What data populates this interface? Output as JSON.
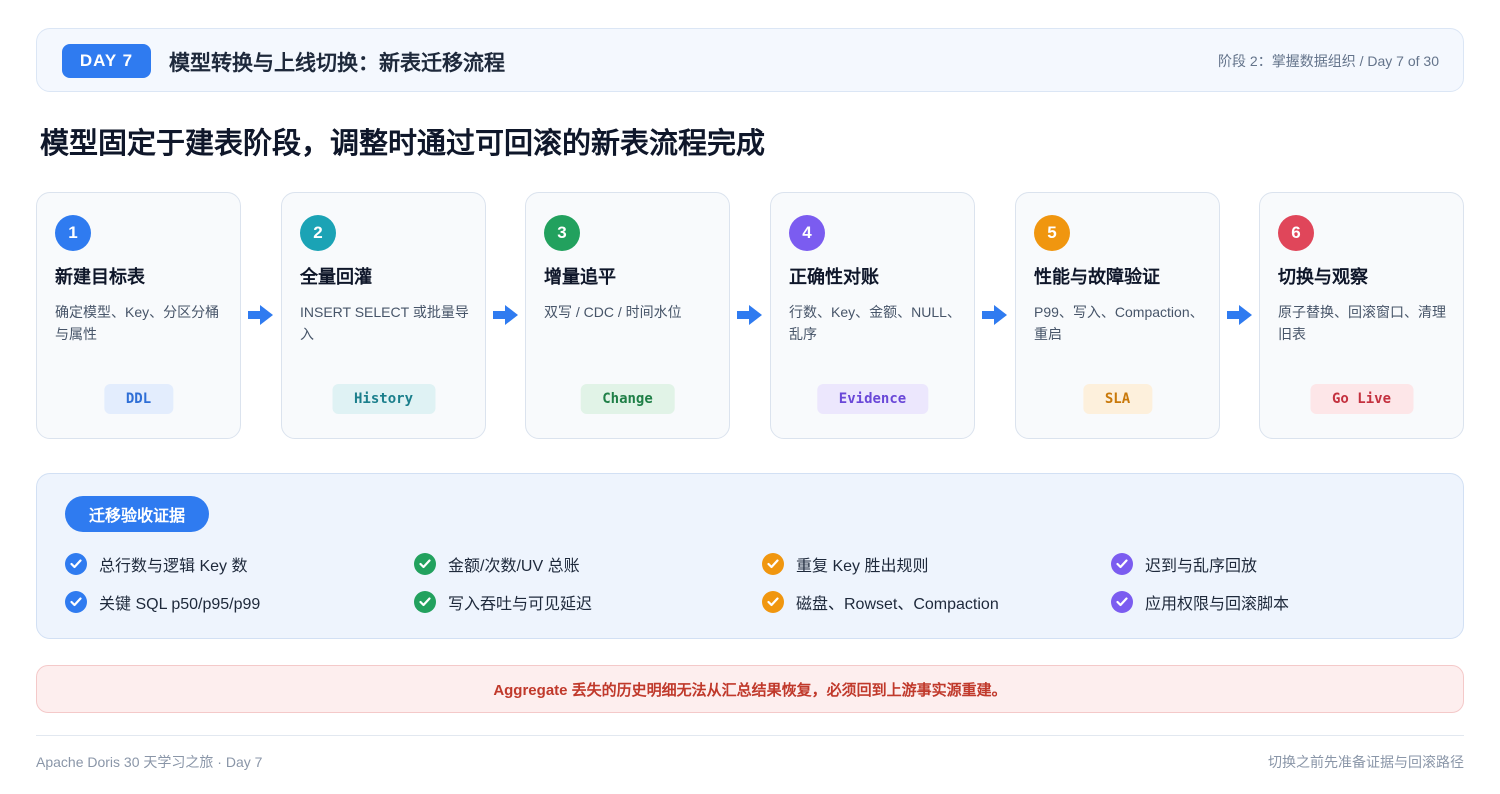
{
  "header": {
    "badge": "DAY 7",
    "title": "模型转换与上线切换：新表迁移流程",
    "meta": "阶段 2：掌握数据组织 / Day 7 of 30"
  },
  "headline": "模型固定于建表阶段，调整时通过可回滚的新表流程完成",
  "steps": [
    {
      "num": "1",
      "title": "新建目标表",
      "desc": "确定模型、Key、分区分桶与属性",
      "tag": "DDL",
      "color": "#2f7bf0",
      "tag_bg": "#e3edfd",
      "tag_fg": "#2f6fd6"
    },
    {
      "num": "2",
      "title": "全量回灌",
      "desc": "INSERT SELECT 或批量导入",
      "tag": "History",
      "color": "#1ba3b5",
      "tag_bg": "#dff2f4",
      "tag_fg": "#1b7f8c"
    },
    {
      "num": "3",
      "title": "增量追平",
      "desc": "双写 / CDC / 时间水位",
      "tag": "Change",
      "color": "#22a15e",
      "tag_bg": "#e1f3e7",
      "tag_fg": "#1f7f47"
    },
    {
      "num": "4",
      "title": "正确性对账",
      "desc": "行数、Key、金额、NULL、乱序",
      "tag": "Evidence",
      "color": "#7b5cf0",
      "tag_bg": "#ece7fd",
      "tag_fg": "#6a48d8"
    },
    {
      "num": "5",
      "title": "性能与故障验证",
      "desc": "P99、写入、Compaction、重启",
      "tag": "SLA",
      "color": "#f0960f",
      "tag_bg": "#fdf0dc",
      "tag_fg": "#c9790a"
    },
    {
      "num": "6",
      "title": "切换与观察",
      "desc": "原子替换、回滚窗口、清理旧表",
      "tag": "Go Live",
      "color": "#e0465a",
      "tag_bg": "#fde6e8",
      "tag_fg": "#c4313f"
    }
  ],
  "evidence": {
    "title": "迁移验收证据",
    "items": [
      {
        "text": "总行数与逻辑 Key 数",
        "color": "#2f7bf0"
      },
      {
        "text": "金额/次数/UV 总账",
        "color": "#22a15e"
      },
      {
        "text": "重复 Key 胜出规则",
        "color": "#f0960f"
      },
      {
        "text": "迟到与乱序回放",
        "color": "#7b5cf0"
      },
      {
        "text": "关键 SQL p50/p95/p99",
        "color": "#2f7bf0"
      },
      {
        "text": "写入吞吐与可见延迟",
        "color": "#22a15e"
      },
      {
        "text": "磁盘、Rowset、Compaction",
        "color": "#f0960f"
      },
      {
        "text": "应用权限与回滚脚本",
        "color": "#7b5cf0"
      }
    ]
  },
  "warning": "Aggregate 丢失的历史明细无法从汇总结果恢复，必须回到上游事实源重建。",
  "footer": {
    "left": "Apache Doris 30 天学习之旅 · Day 7",
    "right": "切换之前先准备证据与回滚路径"
  },
  "colors": {
    "accent": "#2f7bf0",
    "warning_text": "#c0392b"
  }
}
